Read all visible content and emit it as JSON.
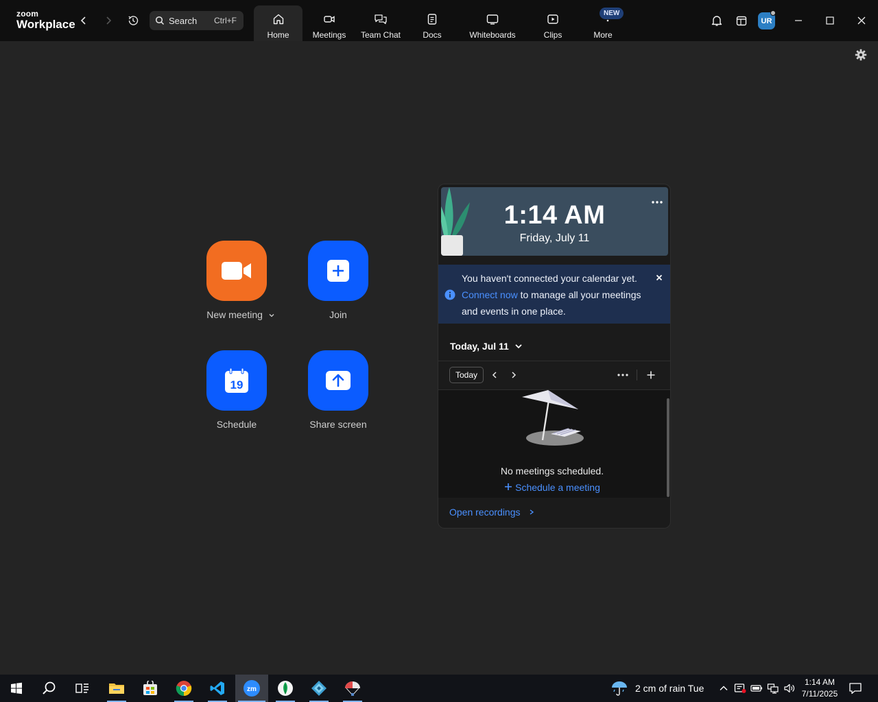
{
  "app": {
    "logo_small": "zoom",
    "logo_big": "Workplace"
  },
  "search": {
    "label": "Search",
    "shortcut": "Ctrl+F"
  },
  "tabs": [
    {
      "label": "Home",
      "icon": "home-icon",
      "active": true
    },
    {
      "label": "Meetings",
      "icon": "video-camera-icon",
      "active": false
    },
    {
      "label": "Team Chat",
      "icon": "chat-bubbles-icon",
      "active": false
    },
    {
      "label": "Docs",
      "icon": "document-icon",
      "active": false
    },
    {
      "label": "Whiteboards",
      "icon": "whiteboard-icon",
      "active": false
    },
    {
      "label": "Clips",
      "icon": "clip-play-icon",
      "active": false
    },
    {
      "label": "More",
      "icon": "more-dots-icon",
      "active": false,
      "badge": "NEW"
    }
  ],
  "user": {
    "initials": "UR"
  },
  "actions": [
    {
      "label": "New meeting",
      "icon": "video-camera-icon",
      "color": "#f26d21",
      "has_dropdown": true
    },
    {
      "label": "Join",
      "icon": "plus-icon",
      "color": "#0b5cff"
    },
    {
      "label": "Schedule",
      "icon": "calendar-icon",
      "color": "#0b5cff",
      "calendar_day": "19"
    },
    {
      "label": "Share screen",
      "icon": "share-arrow-up-icon",
      "color": "#0b5cff"
    }
  ],
  "calendar_panel": {
    "time": "1:14 AM",
    "date": "Friday, July 11",
    "notice": {
      "text_before": "You haven't connected your calendar yet. ",
      "link": "Connect now",
      "text_after": " to manage all your meetings and events in one place."
    },
    "day_selector": "Today, Jul 11",
    "today_button": "Today",
    "empty_message": "No meetings scheduled.",
    "schedule_link": "Schedule a meeting",
    "recordings_link": "Open recordings"
  },
  "taskbar": {
    "apps": [
      "start-icon",
      "search-icon",
      "task-view-icon",
      "file-explorer-icon",
      "store-icon",
      "chrome-icon",
      "vscode-icon",
      "zoom-icon",
      "mongodb-compass-icon",
      "app-diamond-icon",
      "app-parachute-icon"
    ],
    "active_app": "zoom-icon",
    "weather": "2 cm of rain Tue",
    "time": "1:14 AM",
    "date": "7/11/2025"
  },
  "colors": {
    "accent_blue": "#0b5cff",
    "accent_orange": "#f26d21",
    "link_blue": "#4a90ff",
    "background": "#242424"
  }
}
